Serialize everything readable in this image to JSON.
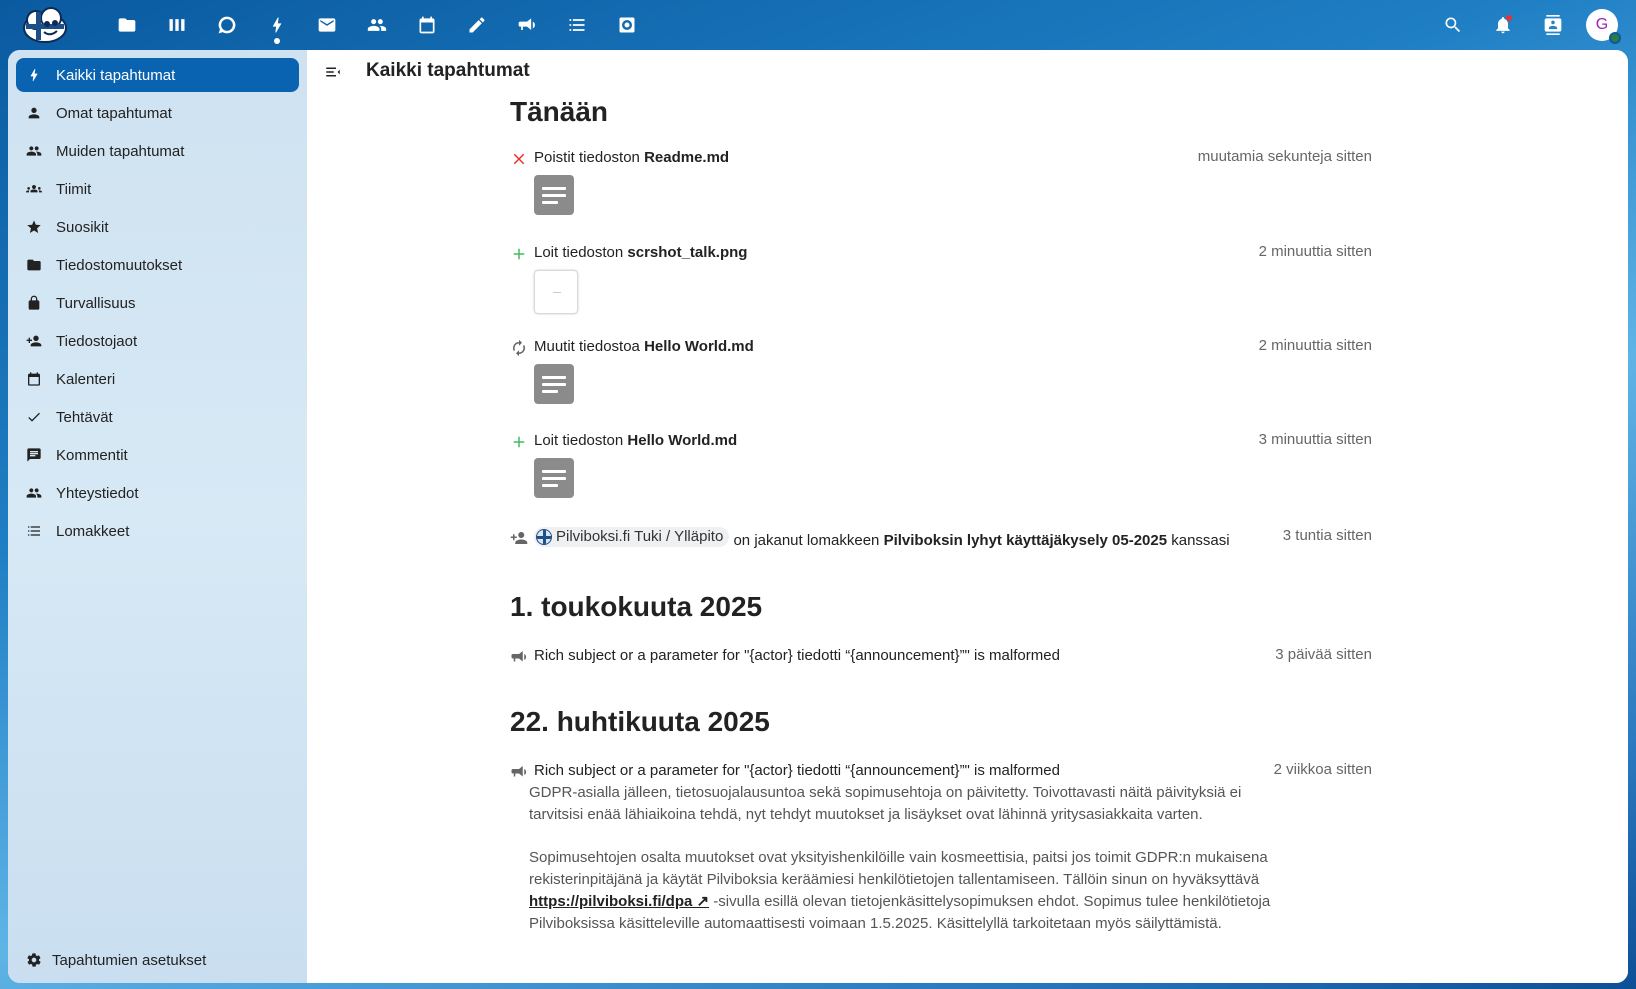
{
  "header": {
    "apps": [
      {
        "name": "files-icon"
      },
      {
        "name": "deck-icon"
      },
      {
        "name": "talk-icon"
      },
      {
        "name": "activity-icon",
        "active": true
      },
      {
        "name": "mail-icon"
      },
      {
        "name": "contacts-icon"
      },
      {
        "name": "calendar-icon"
      },
      {
        "name": "notes-icon"
      },
      {
        "name": "announcements-icon"
      },
      {
        "name": "tasks-icon"
      },
      {
        "name": "forms-icon"
      }
    ],
    "avatar_letter": "G"
  },
  "sidebar": {
    "items": [
      {
        "label": "Kaikki tapahtumat",
        "icon": "lightning-icon",
        "active": true
      },
      {
        "label": "Omat tapahtumat",
        "icon": "user-icon"
      },
      {
        "label": "Muiden tapahtumat",
        "icon": "users-icon"
      },
      {
        "label": "Tiimit",
        "icon": "teams-icon"
      },
      {
        "label": "Suosikit",
        "icon": "star-icon"
      },
      {
        "label": "Tiedostomuutokset",
        "icon": "folder-icon"
      },
      {
        "label": "Turvallisuus",
        "icon": "lock-icon"
      },
      {
        "label": "Tiedostojaot",
        "icon": "share-icon"
      },
      {
        "label": "Kalenteri",
        "icon": "calendar-icon"
      },
      {
        "label": "Tehtävät",
        "icon": "check-icon"
      },
      {
        "label": "Kommentit",
        "icon": "comment-icon"
      },
      {
        "label": "Yhteystiedot",
        "icon": "contacts-icon"
      },
      {
        "label": "Lomakkeet",
        "icon": "list-icon"
      }
    ],
    "settings_label": "Tapahtumien asetukset"
  },
  "main": {
    "title": "Kaikki tapahtumat",
    "days": [
      {
        "heading": "Tänään",
        "activities": [
          {
            "pre": "Poistit tiedoston ",
            "bold": "Readme.md",
            "time": "muutamia sekunteja sitten"
          },
          {
            "pre": "Loit tiedoston ",
            "bold": "scrshot_talk.png",
            "time": "2 minuuttia sitten"
          },
          {
            "pre": "Muutit tiedostoa ",
            "bold": "Hello World.md",
            "time": "2 minuuttia sitten"
          },
          {
            "pre": "Loit tiedoston ",
            "bold": "Hello World.md",
            "time": "3 minuuttia sitten"
          },
          {
            "actor": "Pilviboksi.fi Tuki / Ylläpito",
            "pre": " on jakanut lomakkeen ",
            "bold": "Pilviboksin lyhyt käyttäjäkysely 05-2025",
            "post": " kanssasi",
            "time": "3 tuntia sitten"
          }
        ]
      },
      {
        "heading": "1. toukokuuta 2025",
        "activities": [
          {
            "text": "Rich subject or a parameter for \"{actor} tiedotti “{announcement}”\" is malformed",
            "time": "3 päivää sitten"
          }
        ]
      },
      {
        "heading": "22. huhtikuuta 2025",
        "activities": [
          {
            "text": "Rich subject or a parameter for \"{actor} tiedotti “{announcement}”\" is malformed",
            "time": "2 viikkoa sitten",
            "message_p1": "GDPR-asialla jälleen, tietosuojalausuntoa sekä sopimusehtoja on päivitetty. Toivottavasti näitä päivityksiä ei tarvitsisi enää lähiaikoina tehdä, nyt tehdyt muutokset ja lisäykset ovat lähinnä yritysasiakkaita varten.",
            "message_p2_a": "Sopimusehtojen osalta muutokset ovat yksityishenkilöille vain kosmeettisia, paitsi jos toimit GDPR:n mukaisena rekisterinpitäjänä ja käytät Pilviboksia keräämiesi henkilötietojen tallentamiseen. Tällöin sinun on hyväksyttävä ",
            "message_link": "https://pilviboksi.fi/dpa ↗",
            "message_p2_b": " -sivulla esillä olevan tietojenkäsittelysopimuksen ehdot. Sopimus tulee henkilötietoja Pilviboksissa käsitteleville automaattisesti voimaan 1.5.2025. Käsittelyllä tarkoitetaan myös säilyttämistä."
          }
        ]
      }
    ]
  },
  "colors": {
    "accent": "#0a63b0",
    "delete": "#e9322d",
    "create": "#46ba61"
  }
}
